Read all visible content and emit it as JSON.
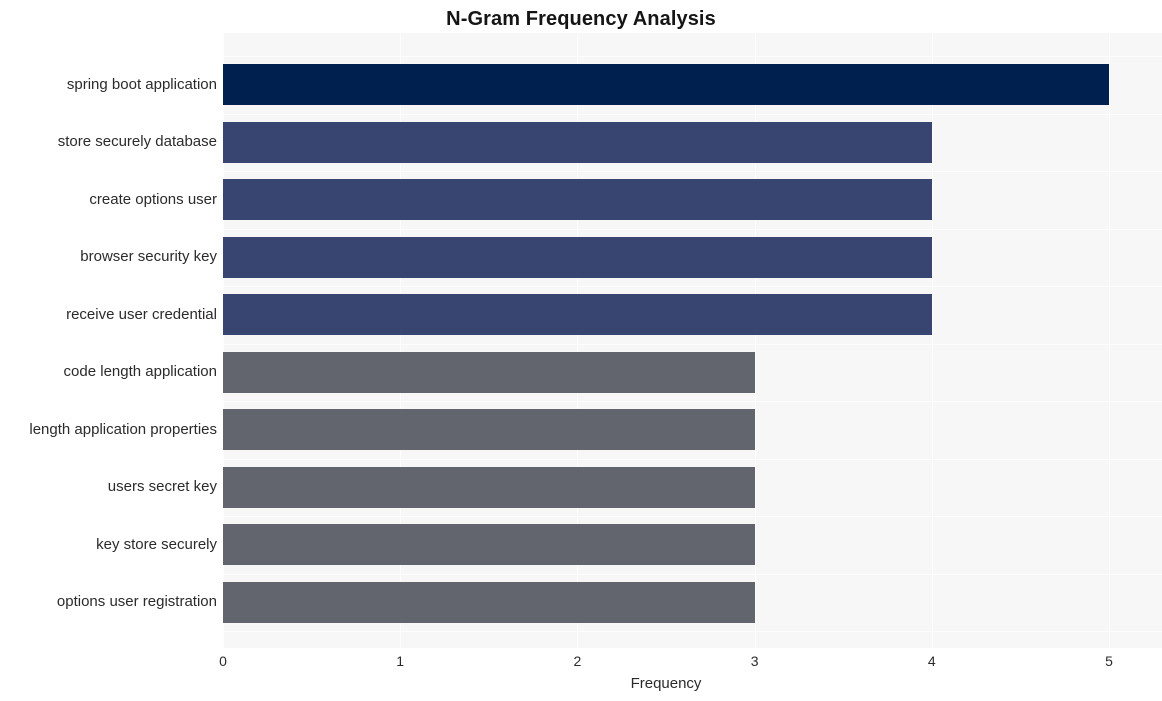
{
  "chart_data": {
    "type": "bar",
    "orientation": "horizontal",
    "title": "N-Gram Frequency Analysis",
    "xlabel": "Frequency",
    "ylabel": "",
    "xlim": [
      0,
      5
    ],
    "xticks": [
      0,
      1,
      2,
      3,
      4,
      5
    ],
    "xtick_labels": [
      "0",
      "1",
      "2",
      "3",
      "4",
      "5"
    ],
    "grid": true,
    "legend": null,
    "categories": [
      "spring boot application",
      "store securely database",
      "create options user",
      "browser security key",
      "receive user credential",
      "code length application",
      "length application properties",
      "users secret key",
      "key store securely",
      "options user registration"
    ],
    "values": [
      5,
      4,
      4,
      4,
      4,
      3,
      3,
      3,
      3,
      3
    ],
    "bar_colors": [
      "#002150",
      "#374570",
      "#374570",
      "#374570",
      "#374570",
      "#63656e",
      "#63656e",
      "#63656e",
      "#63656e",
      "#63656e"
    ],
    "plot_background": "#f7f7f7",
    "page_background": "#ffffff",
    "gridline_color": "#fdfdfd",
    "text_color": "#2b2b2b",
    "title_color": "#151515"
  }
}
